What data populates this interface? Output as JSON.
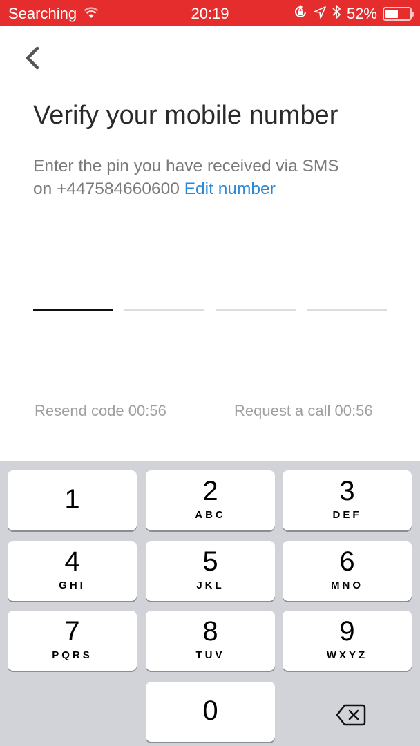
{
  "status_bar": {
    "carrier": "Searching",
    "time": "20:19",
    "battery_percent_label": "52%",
    "battery_level": 0.52,
    "icons": [
      "wifi-icon",
      "rotation-lock-icon",
      "location-icon",
      "bluetooth-icon",
      "battery-icon"
    ],
    "background_color": "#e52d2d"
  },
  "header": {
    "back_icon": "chevron-left-icon",
    "title": "Verify your mobile number"
  },
  "instructions": {
    "text_line1": "Enter the pin you have received via SMS",
    "text_prefix": "on ",
    "phone_number": "+447584660600",
    "edit_link": "Edit number",
    "link_color": "#2a88d8"
  },
  "pin": {
    "length": 4,
    "active_index": 0,
    "values": [
      "",
      "",
      "",
      ""
    ]
  },
  "actions": {
    "resend_label": "Resend code 00:56",
    "request_call_label": "Request a call 00:56"
  },
  "keypad": {
    "keys": [
      {
        "digit": "1",
        "letters": ""
      },
      {
        "digit": "2",
        "letters": "ABC"
      },
      {
        "digit": "3",
        "letters": "DEF"
      },
      {
        "digit": "4",
        "letters": "GHI"
      },
      {
        "digit": "5",
        "letters": "JKL"
      },
      {
        "digit": "6",
        "letters": "MNO"
      },
      {
        "digit": "7",
        "letters": "PQRS"
      },
      {
        "digit": "8",
        "letters": "TUV"
      },
      {
        "digit": "9",
        "letters": "WXYZ"
      },
      {
        "digit": "0",
        "letters": ""
      }
    ],
    "delete_icon": "backspace-icon"
  }
}
